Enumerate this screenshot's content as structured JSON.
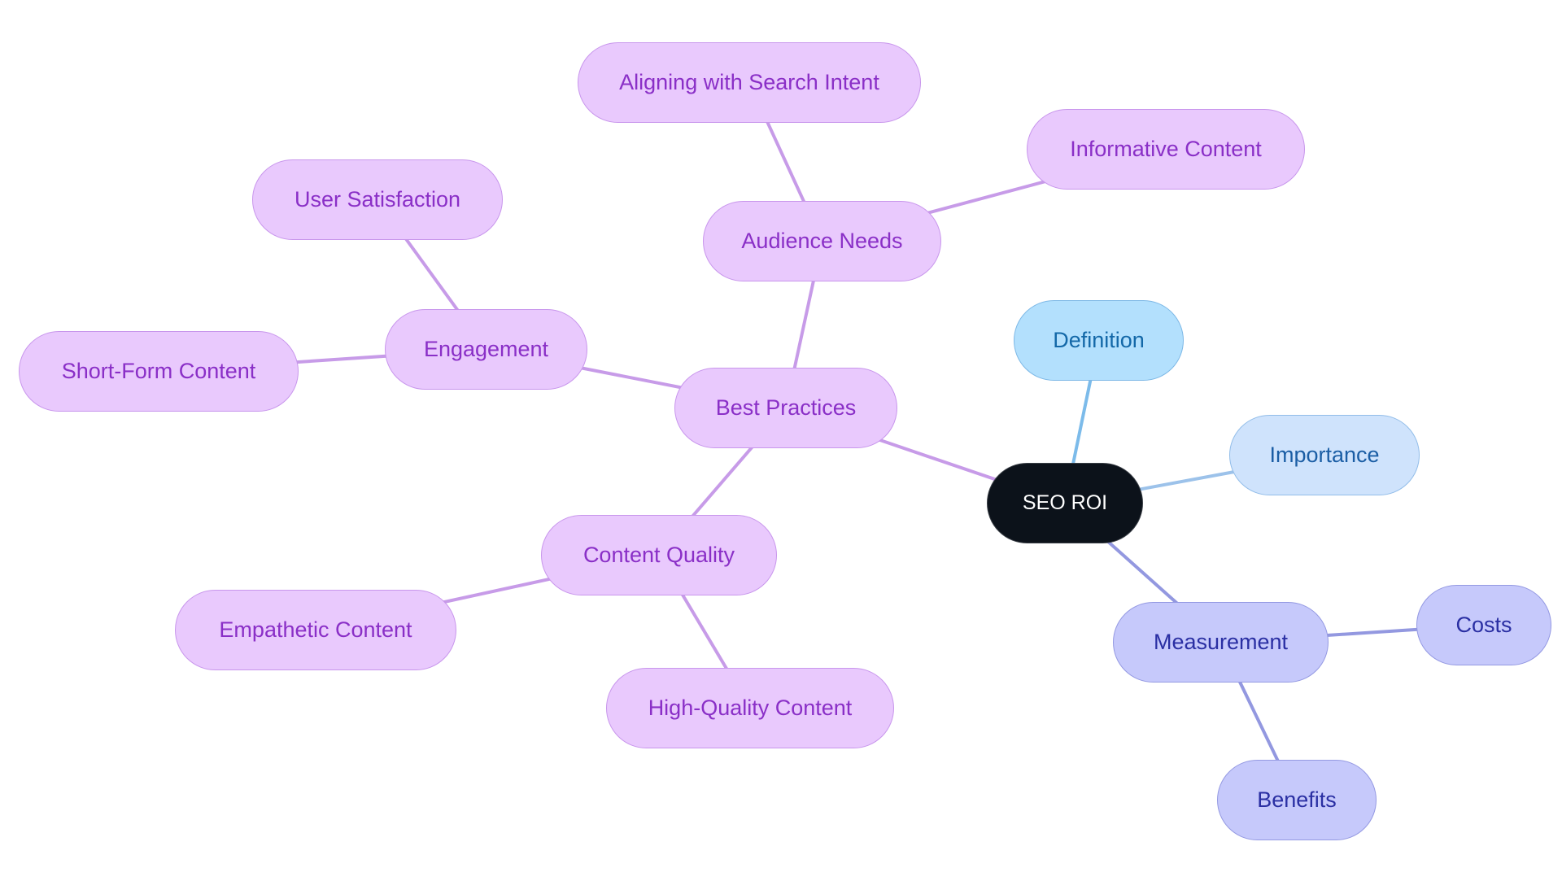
{
  "diagram": {
    "type": "mind-map",
    "root": "SEO ROI",
    "colors": {
      "purple_edge": "#c79be8",
      "blue_edge": "#7cbbea",
      "lblue_edge": "#9cc2ea",
      "indigo_edge": "#9398e0"
    },
    "nodes": {
      "root": "SEO ROI",
      "definition": "Definition",
      "importance": "Importance",
      "measurement": "Measurement",
      "costs": "Costs",
      "benefits": "Benefits",
      "best_practices": "Best Practices",
      "audience_needs": "Audience Needs",
      "aligning": "Aligning with Search Intent",
      "informative": "Informative Content",
      "engagement": "Engagement",
      "user_satisfaction": "User Satisfaction",
      "short_form": "Short-Form Content",
      "content_quality": "Content Quality",
      "empathetic": "Empathetic Content",
      "high_quality": "High-Quality Content"
    },
    "edges": [
      [
        "root",
        "best_practices",
        "purple_edge"
      ],
      [
        "root",
        "definition",
        "blue_edge"
      ],
      [
        "root",
        "importance",
        "lblue_edge"
      ],
      [
        "root",
        "measurement",
        "indigo_edge"
      ],
      [
        "measurement",
        "costs",
        "indigo_edge"
      ],
      [
        "measurement",
        "benefits",
        "indigo_edge"
      ],
      [
        "best_practices",
        "audience_needs",
        "purple_edge"
      ],
      [
        "audience_needs",
        "aligning",
        "purple_edge"
      ],
      [
        "audience_needs",
        "informative",
        "purple_edge"
      ],
      [
        "best_practices",
        "engagement",
        "purple_edge"
      ],
      [
        "engagement",
        "user_satisfaction",
        "purple_edge"
      ],
      [
        "engagement",
        "short_form",
        "purple_edge"
      ],
      [
        "best_practices",
        "content_quality",
        "purple_edge"
      ],
      [
        "content_quality",
        "empathetic",
        "purple_edge"
      ],
      [
        "content_quality",
        "high_quality",
        "purple_edge"
      ]
    ]
  }
}
